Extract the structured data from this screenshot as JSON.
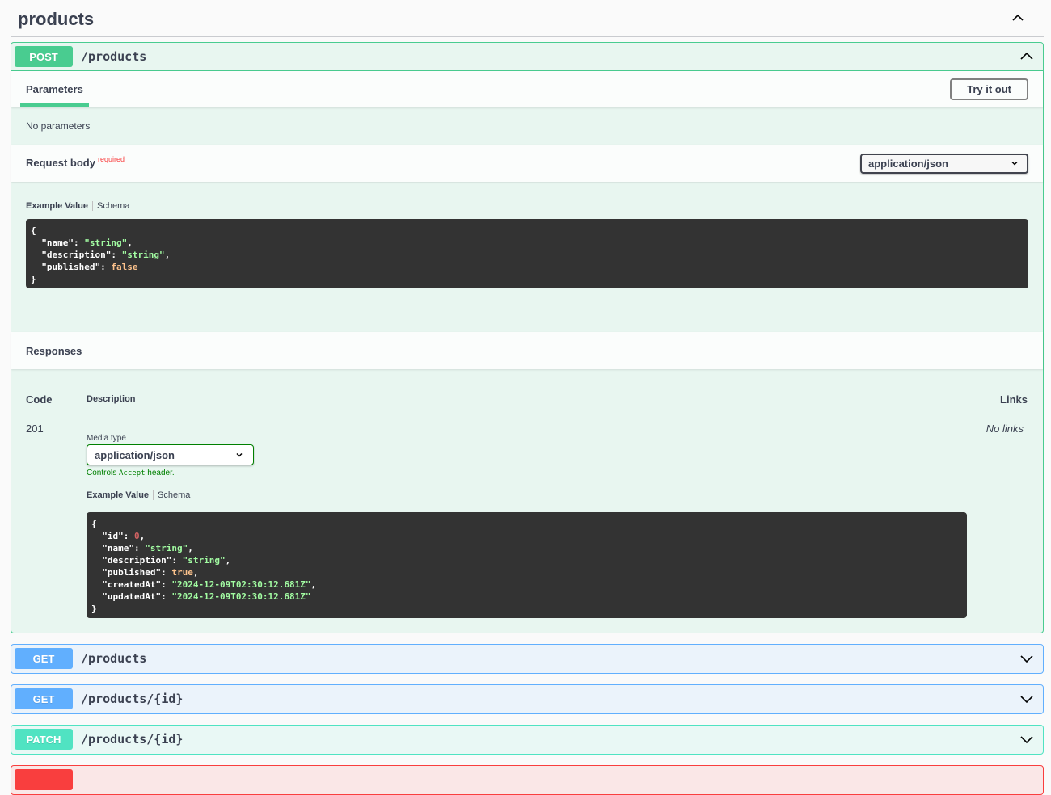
{
  "tag": {
    "title": "products",
    "toggle_icon": "chevron-up-icon"
  },
  "colors": {
    "post": "#49cc90",
    "get": "#61affe",
    "patch": "#50e3c2",
    "delete": "#f93e3e",
    "required": "#f93e3e",
    "controls_accept": "#008000"
  },
  "post_op": {
    "method": "POST",
    "path": "/products",
    "toggle_icon": "chevron-up-icon",
    "parameters_tab": "Parameters",
    "try_it_out": "Try it out",
    "no_parameters": "No parameters",
    "request_body": {
      "title": "Request body",
      "required_label": "required",
      "content_type": "application/json",
      "example_tab": "Example Value",
      "schema_tab": "Schema",
      "example": {
        "open": "{",
        "close": "}",
        "lines": [
          {
            "key": "\"name\"",
            "value": "\"string\"",
            "type": "string",
            "comma": true
          },
          {
            "key": "\"description\"",
            "value": "\"string\"",
            "type": "string",
            "comma": true
          },
          {
            "key": "\"published\"",
            "value": "false",
            "type": "bool",
            "comma": false
          }
        ]
      }
    },
    "responses": {
      "title": "Responses",
      "headers": {
        "code": "Code",
        "description": "Description",
        "links": "Links"
      },
      "rows": [
        {
          "code": "201",
          "media_type_label": "Media type",
          "media_type": "application/json",
          "controls_prefix": "Controls ",
          "controls_code": "Accept",
          "controls_suffix": " header.",
          "example_tab": "Example Value",
          "schema_tab": "Schema",
          "links": "No links",
          "example": {
            "open": "{",
            "close": "}",
            "lines": [
              {
                "key": "\"id\"",
                "value": "0",
                "type": "number",
                "comma": true
              },
              {
                "key": "\"name\"",
                "value": "\"string\"",
                "type": "string",
                "comma": true
              },
              {
                "key": "\"description\"",
                "value": "\"string\"",
                "type": "string",
                "comma": true
              },
              {
                "key": "\"published\"",
                "value": "true",
                "type": "bool",
                "comma": true
              },
              {
                "key": "\"createdAt\"",
                "value": "\"2024-12-09T02:30:12.681Z\"",
                "type": "string",
                "comma": true
              },
              {
                "key": "\"updatedAt\"",
                "value": "\"2024-12-09T02:30:12.681Z\"",
                "type": "string",
                "comma": false
              }
            ]
          }
        }
      ]
    }
  },
  "collapsed_ops": [
    {
      "method": "GET",
      "path": "/products",
      "toggle_icon": "chevron-down-icon"
    },
    {
      "method": "GET",
      "path": "/products/{id}",
      "toggle_icon": "chevron-down-icon"
    },
    {
      "method": "PATCH",
      "path": "/products/{id}",
      "toggle_icon": "chevron-down-icon"
    },
    {
      "method": "",
      "path": "",
      "toggle_icon": ""
    }
  ]
}
